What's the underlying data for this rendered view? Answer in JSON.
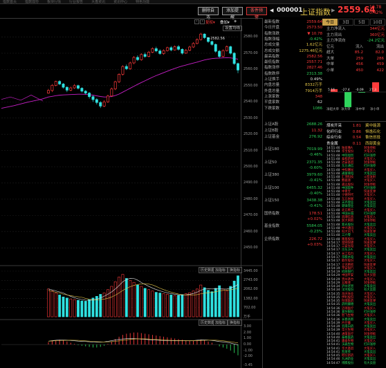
{
  "menubar": [
    "指数首页",
    "指数成份",
    "板块行情",
    "行业报告",
    "大盘资讯",
    "资讯中心",
    "特色功能"
  ],
  "toolbar": {
    "btn1": "删除自选",
    "btn2": "添加提醒",
    "btn3": "条件预警"
  },
  "index_header": {
    "code": "000001",
    "name": "上证指数",
    "price": "2559.64",
    "change": "10.78",
    "pct": "0.42%"
  },
  "timeframe_tabs": [
    "当日",
    "3日",
    "5日",
    "10日"
  ],
  "chart_controls": {
    "fq": "复权",
    "overlay": "叠加",
    "settings": "设置均线"
  },
  "candle_chart": {
    "high_label": "2582.56",
    "y_ticks": [
      "2580.00",
      "2570.00",
      "2560.00",
      "2550.00",
      "2540.00",
      "2530.00",
      "2520.00",
      "2510.00",
      "2500.00",
      "2490.00",
      "2480.00",
      "2470.00",
      "2460.00",
      "2450.00"
    ]
  },
  "volume_pane": {
    "buttons": [
      "历史数据",
      "加指标",
      "换指标"
    ],
    "y_ticks": [
      "3445.00",
      "2743.00",
      "2062.00",
      "1382.00",
      "702.00"
    ],
    "unit": "万手"
  },
  "macd_pane": {
    "buttons": [
      "历史数据",
      "加指标",
      "换指标"
    ],
    "y_ticks": [
      "3.00",
      "2.00",
      "1.00",
      "0.00",
      "-1.00",
      "-2.00",
      "-3.45"
    ]
  },
  "stats": [
    {
      "label": "最新指数",
      "value": "2559.64",
      "color": "red"
    },
    {
      "label": "今日开盘",
      "value": "2573.50",
      "color": "red"
    },
    {
      "label": "指数涨跌",
      "value": "▼ 10.78",
      "color": "red"
    },
    {
      "label": "指数涨幅",
      "value": "-0.42%",
      "color": "green"
    },
    {
      "label": "总成交量",
      "value": "1.62亿元",
      "color": "yellow"
    },
    {
      "label": "总成交额",
      "value": "1275.46亿元",
      "color": "yellow"
    },
    {
      "label": "最高指数",
      "value": "2582.56",
      "color": "red"
    },
    {
      "label": "最低指数",
      "value": "2557.71",
      "color": "red"
    },
    {
      "label": "指数涨停",
      "value": "2827.46",
      "color": "red"
    },
    {
      "label": "指数跌停",
      "value": "2313.38",
      "color": "green"
    },
    {
      "label": "上证换手",
      "value": "0.49%",
      "color": "white"
    },
    {
      "label": "内盘总量",
      "value": "8332万手",
      "color": "yellow"
    },
    {
      "label": "外盘总量",
      "value": "7914万手",
      "color": "yellow"
    },
    {
      "label": "上涨家数",
      "value": "348",
      "color": "red"
    },
    {
      "label": "平盘家数",
      "value": "62",
      "color": "white"
    },
    {
      "label": "下跌家数",
      "value": "1086",
      "color": "green"
    }
  ],
  "indices": [
    {
      "label": "上证A股",
      "value": "2688.26",
      "chg": "-0.42%"
    },
    {
      "label": "上证B股",
      "value": "11.32",
      "chg": "+0.09%"
    },
    {
      "label": "上证基金",
      "value": "276.92",
      "chg": "-0.11%"
    },
    {
      "label": "上证180",
      "value": "7019.99",
      "chg": "-0.46%"
    },
    {
      "label": "上证50",
      "value": "2371.35",
      "chg": "-0.60%"
    },
    {
      "label": "上证380",
      "value": "3979.60",
      "chg": "-0.41%"
    },
    {
      "label": "上证100",
      "value": "6455.32",
      "chg": "-0.40%"
    },
    {
      "label": "上证150",
      "value": "3438.38",
      "chg": "-0.41%"
    },
    {
      "label": "国债指数",
      "value": "178.51",
      "chg": "+0.02%"
    },
    {
      "label": "基金指数",
      "value": "5584.05",
      "chg": "-0.23%"
    },
    {
      "label": "企债指数",
      "value": "226.72",
      "chg": "+0.03%"
    }
  ],
  "capital_tabs": [
    "今日",
    "3日",
    "5日",
    "10日"
  ],
  "capital_flow": [
    {
      "label": "主力净流入",
      "value": "344亿元",
      "color": "red"
    },
    {
      "label": "主力流出",
      "value": "360亿元",
      "color": "red"
    },
    {
      "label": "主力净流向",
      "value": "-24.2亿元",
      "color": "green"
    }
  ],
  "fund_table": {
    "header": [
      "亿元",
      "流入",
      "流出"
    ],
    "rows": [
      {
        "label": "超大",
        "in": "85.2",
        "out": "82.0"
      },
      {
        "label": "大单",
        "in": "259",
        "out": "286"
      },
      {
        "label": "中单",
        "in": "456",
        "out": "459"
      },
      {
        "label": "小单",
        "in": "450",
        "out": "422"
      }
    ]
  },
  "fund_bars": {
    "labels": [
      "5.16",
      "-27.4",
      "-0.09",
      "27.3"
    ],
    "captions": [
      "净超大单",
      "净大单",
      "净中单",
      "净小单"
    ],
    "values": [
      5.16,
      -27.4,
      -0.09,
      27.3
    ]
  },
  "sectors": [
    {
      "name": "煤炭开采",
      "pct": "1.81",
      "lead": "冀中能源"
    },
    {
      "name": "化纤行业",
      "pct": "0.86",
      "lead": "恒逸石化"
    },
    {
      "name": "综合行业",
      "pct": "0.54",
      "lead": "鲁信创投"
    },
    {
      "name": "贵金属",
      "pct": "0.11",
      "lead": "西部黄金"
    }
  ],
  "trades": [
    {
      "t": "14:51:46",
      "stock": "陆家嘴A",
      "action": "封涨停板"
    },
    {
      "t": "14:51:48",
      "stock": "华宝股份",
      "action": "大笔买入"
    },
    {
      "t": "14:51:48",
      "stock": "中际旭创",
      "action": "打开涨停"
    },
    {
      "t": "14:51:48",
      "stock": "泰和新材",
      "action": "大笔买入"
    },
    {
      "t": "14:51:48",
      "stock": "达安基因",
      "action": "封涨停板"
    },
    {
      "t": "14:51:48",
      "stock": "东方通信",
      "action": "打开涨停"
    },
    {
      "t": "14:51:48",
      "stock": "中科曙光",
      "action": "大笔买入"
    },
    {
      "t": "14:51:48",
      "stock": "通富微电",
      "action": "大笔卖出"
    },
    {
      "t": "14:51:48",
      "stock": "汇顶科技",
      "action": "火箭发射"
    },
    {
      "t": "14:51:48",
      "stock": "数据港",
      "action": "大笔买入"
    },
    {
      "t": "14:51:48",
      "stock": "森远股份",
      "action": "封涨停板"
    },
    {
      "t": "14:51:48",
      "stock": "中国软件",
      "action": "打开涨停"
    },
    {
      "t": "14:51:48",
      "stock": "中青宝",
      "action": "快速反弹"
    },
    {
      "t": "14:51:48",
      "stock": "宁德时代",
      "action": "大笔买入"
    },
    {
      "t": "14:51:48",
      "stock": "东方财富",
      "action": "大笔买入"
    },
    {
      "t": "14:51:48",
      "stock": "天齐锂业",
      "action": "大笔卖出"
    },
    {
      "t": "14:51:48",
      "stock": "赣锋锂业",
      "action": "大笔卖出"
    },
    {
      "t": "14:51:48",
      "stock": "北方稀土",
      "action": "大笔买入"
    },
    {
      "t": "14:51:48",
      "stock": "中国长城",
      "action": "打开涨停"
    },
    {
      "t": "14:51:48",
      "stock": "浪潮信息",
      "action": "大笔买入"
    },
    {
      "t": "14:51:48",
      "stock": "浙大网新",
      "action": "封涨停板"
    },
    {
      "t": "14:51:48",
      "stock": "紫光股份",
      "action": "大笔卖出"
    },
    {
      "t": "14:51:48",
      "stock": "中兴通讯",
      "action": "大笔买入"
    },
    {
      "t": "14:51:48",
      "stock": "科大讯飞",
      "action": "快速反弹"
    },
    {
      "t": "14:51:48",
      "stock": "三六零",
      "action": "大笔卖出"
    },
    {
      "t": "14:51:48",
      "stock": "隆基股份",
      "action": "大笔买入"
    },
    {
      "t": "14:54:17",
      "stock": "星网锐捷",
      "action": "快速反弹"
    },
    {
      "t": "14:54:17",
      "stock": "三安光电",
      "action": "大笔买入"
    },
    {
      "t": "14:54:17",
      "stock": "京东方A",
      "action": "大笔卖出"
    },
    {
      "t": "14:54:17",
      "stock": "长江电力",
      "action": "大笔买入"
    },
    {
      "t": "14:54:17",
      "stock": "华能水电",
      "action": "大笔卖出"
    },
    {
      "t": "14:54:17",
      "stock": "歌尔股份",
      "action": "大笔买入"
    },
    {
      "t": "14:54:17",
      "stock": "立讯精密",
      "action": "快速反弹"
    },
    {
      "t": "14:54:19",
      "stock": "平安银行",
      "action": "大笔买入"
    },
    {
      "t": "14:54:19",
      "stock": "招商银行",
      "action": "大笔卖出"
    },
    {
      "t": "14:54:29",
      "stock": "中国平安",
      "action": "有大买盘"
    },
    {
      "t": "14:54:29",
      "stock": "贵州茅台",
      "action": "大笔买入"
    },
    {
      "t": "14:54:29",
      "stock": "五粮液",
      "action": "封涨停板"
    },
    {
      "t": "14:54:34",
      "stock": "泸州老窖",
      "action": "大笔卖出"
    },
    {
      "t": "14:54:34",
      "stock": "洋河股份",
      "action": "有大卖盘"
    },
    {
      "t": "14:54:35",
      "stock": "海天味业",
      "action": "大笔买入"
    },
    {
      "t": "14:54:35",
      "stock": "伊利股份",
      "action": "大笔买入"
    },
    {
      "t": "14:54:35",
      "stock": "恒瑞医药",
      "action": "快速反弹"
    },
    {
      "t": "14:54:35",
      "stock": "药明康德",
      "action": "大笔卖出"
    },
    {
      "t": "14:54:36",
      "stock": "迈瑞医疗",
      "action": "大笔买入"
    },
    {
      "t": "14:54:36",
      "stock": "爱尔眼科",
      "action": "打开涨停"
    },
    {
      "t": "14:54:36",
      "stock": "智飞生物",
      "action": "大笔买入"
    },
    {
      "t": "14:54:36",
      "stock": "长春高新",
      "action": "大笔卖出"
    },
    {
      "t": "14:54:39",
      "stock": "片仔癀",
      "action": "大笔买入"
    },
    {
      "t": "14:54:39",
      "stock": "云南白药",
      "action": "大笔卖出"
    },
    {
      "t": "14:54:39",
      "stock": "华兰生物",
      "action": "大笔买入"
    },
    {
      "t": "14:54:40",
      "stock": "通策医疗",
      "action": "封涨停板"
    },
    {
      "t": "14:54:40",
      "stock": "泰格医药",
      "action": "大笔卖出"
    },
    {
      "t": "14:54:41",
      "stock": "康泰生物",
      "action": "大笔买入"
    },
    {
      "t": "14:54:41",
      "stock": "沃森生物",
      "action": "打开涨停"
    },
    {
      "t": "14:54:41",
      "stock": "华大基因",
      "action": "大笔买入"
    },
    {
      "t": "14:54:41",
      "stock": "凯莱英",
      "action": "大笔卖出"
    },
    {
      "t": "14:54:45",
      "stock": "昭衍新药",
      "action": "大笔买入"
    },
    {
      "t": "14:54:46",
      "stock": "九洲药业",
      "action": "大笔卖出"
    },
    {
      "t": "14:54:47",
      "stock": "博腾股份",
      "action": "有大卖盘"
    }
  ],
  "chart_data": {
    "type": "candlestick",
    "candles": [
      [
        2545.4,
        2547.0,
        2545.0,
        2548.0
      ],
      [
        2547.0,
        2550.2,
        2546.0,
        2551.0
      ],
      [
        2550.2,
        2552.6,
        2549.6,
        2553.0
      ],
      [
        2552.6,
        2551.0,
        2550.4,
        2553.4
      ],
      [
        2551.0,
        2549.0,
        2548.2,
        2551.6
      ],
      [
        2549.0,
        2547.2,
        2546.0,
        2549.6
      ],
      [
        2547.2,
        2548.6,
        2546.6,
        2549.4
      ],
      [
        2548.6,
        2550.0,
        2548.0,
        2551.0
      ],
      [
        2550.0,
        2548.4,
        2547.6,
        2550.6
      ],
      [
        2548.4,
        2546.6,
        2545.8,
        2549.0
      ],
      [
        2546.6,
        2545.4,
        2544.6,
        2547.2
      ],
      [
        2545.4,
        2543.2,
        2542.0,
        2546.0
      ],
      [
        2543.2,
        2541.4,
        2540.0,
        2544.0
      ],
      [
        2541.4,
        2539.6,
        2538.4,
        2542.2
      ],
      [
        2539.6,
        2537.4,
        2536.2,
        2540.4
      ],
      [
        2537.4,
        2540.0,
        2536.8,
        2541.0
      ],
      [
        2540.0,
        2543.6,
        2539.4,
        2544.4
      ],
      [
        2543.6,
        2548.0,
        2543.0,
        2548.8
      ],
      [
        2548.0,
        2552.4,
        2547.2,
        2553.0
      ],
      [
        2552.4,
        2557.0,
        2551.6,
        2557.6
      ],
      [
        2557.0,
        2561.8,
        2556.2,
        2562.6
      ],
      [
        2561.8,
        2560.4,
        2559.6,
        2563.0
      ],
      [
        2560.4,
        2564.0,
        2559.8,
        2564.8
      ],
      [
        2564.0,
        2567.4,
        2563.2,
        2568.2
      ],
      [
        2567.4,
        2566.0,
        2565.2,
        2568.6
      ],
      [
        2566.0,
        2569.2,
        2565.4,
        2570.0
      ],
      [
        2569.2,
        2568.0,
        2567.2,
        2570.4
      ],
      [
        2568.0,
        2570.6,
        2567.4,
        2571.4
      ],
      [
        2570.6,
        2572.8,
        2570.0,
        2573.6
      ],
      [
        2572.8,
        2571.4,
        2570.6,
        2574.0
      ],
      [
        2571.4,
        2569.8,
        2569.0,
        2572.4
      ],
      [
        2569.8,
        2571.6,
        2569.0,
        2572.4
      ],
      [
        2571.6,
        2573.4,
        2571.0,
        2574.0
      ],
      [
        2573.4,
        2572.0,
        2571.2,
        2574.4
      ],
      [
        2572.0,
        2574.0,
        2571.6,
        2574.8
      ],
      [
        2574.0,
        2572.4,
        2571.6,
        2575.0
      ],
      [
        2572.4,
        2570.0,
        2569.2,
        2573.0
      ],
      [
        2570.0,
        2571.8,
        2569.6,
        2572.6
      ],
      [
        2571.8,
        2573.8,
        2571.2,
        2574.6
      ],
      [
        2573.8,
        2576.0,
        2573.2,
        2576.8
      ],
      [
        2576.0,
        2578.4,
        2575.4,
        2579.2
      ],
      [
        2578.4,
        2581.8,
        2577.8,
        2582.56
      ],
      [
        2581.8,
        2579.6,
        2578.8,
        2582.2
      ],
      [
        2579.6,
        2577.2,
        2576.4,
        2580.0
      ],
      [
        2577.2,
        2575.4,
        2574.6,
        2577.8
      ],
      [
        2575.4,
        2571.2,
        2570.4,
        2576.0
      ],
      [
        2571.2,
        2568.0,
        2567.2,
        2572.0
      ],
      [
        2568.0,
        2571.6,
        2567.4,
        2572.4
      ],
      [
        2571.6,
        2574.0,
        2571.0,
        2574.8
      ],
      [
        2574.0,
        2570.0,
        2569.2,
        2574.6
      ],
      [
        2570.0,
        2563.6,
        2562.8,
        2570.6
      ],
      [
        2563.6,
        2559.6,
        2557.71,
        2564.2
      ]
    ],
    "ma": [
      2543.0,
      2543.4,
      2543.8,
      2544.1,
      2544.3,
      2544.4,
      2544.5,
      2544.6,
      2544.7,
      2544.7,
      2544.6,
      2544.4,
      2544.1,
      2543.7,
      2543.3,
      2543.0,
      2543.0,
      2543.3,
      2543.9,
      2544.8,
      2546.0,
      2547.2,
      2548.4,
      2549.6,
      2550.8,
      2551.9,
      2553.0,
      2554.1,
      2555.2,
      2556.2,
      2557.1,
      2558.0,
      2558.9,
      2559.8,
      2560.6,
      2561.4,
      2562.1,
      2562.7,
      2563.3,
      2563.9,
      2564.5,
      2565.2,
      2565.8,
      2566.3,
      2566.7,
      2566.9,
      2567.0,
      2567.1,
      2567.2,
      2567.1,
      2566.8,
      2566.3
    ],
    "volumes": [
      2100,
      1950,
      1800,
      1650,
      1500,
      1420,
      1350,
      1300,
      1250,
      1200,
      1180,
      1300,
      1420,
      1550,
      1700,
      1800,
      2050,
      2300,
      2650,
      3000,
      3200,
      2900,
      2750,
      2600,
      2400,
      2300,
      2150,
      2050,
      1950,
      1850,
      1800,
      1750,
      1700,
      1650,
      1600,
      1620,
      1680,
      1750,
      1820,
      1950,
      2100,
      2400,
      2200,
      2000,
      1900,
      2150,
      2350,
      2100,
      1950,
      2300,
      2700,
      3100
    ],
    "macd": [
      0.4,
      0.6,
      0.7,
      0.8,
      0.7,
      0.5,
      0.3,
      0.1,
      -0.1,
      -0.2,
      -0.3,
      -0.4,
      -0.5,
      -0.5,
      -0.4,
      -0.2,
      0.1,
      0.5,
      0.9,
      1.3,
      1.6,
      1.8,
      1.9,
      2.0,
      2.0,
      1.9,
      1.8,
      1.7,
      1.6,
      1.5,
      1.4,
      1.3,
      1.2,
      1.1,
      1.0,
      0.9,
      0.8,
      0.7,
      0.6,
      0.6,
      0.7,
      0.8,
      0.7,
      0.5,
      0.3,
      0.0,
      -0.3,
      -0.5,
      -0.7,
      -1.0,
      -1.4,
      -1.8
    ],
    "ylim": [
      2445,
      2590
    ]
  }
}
